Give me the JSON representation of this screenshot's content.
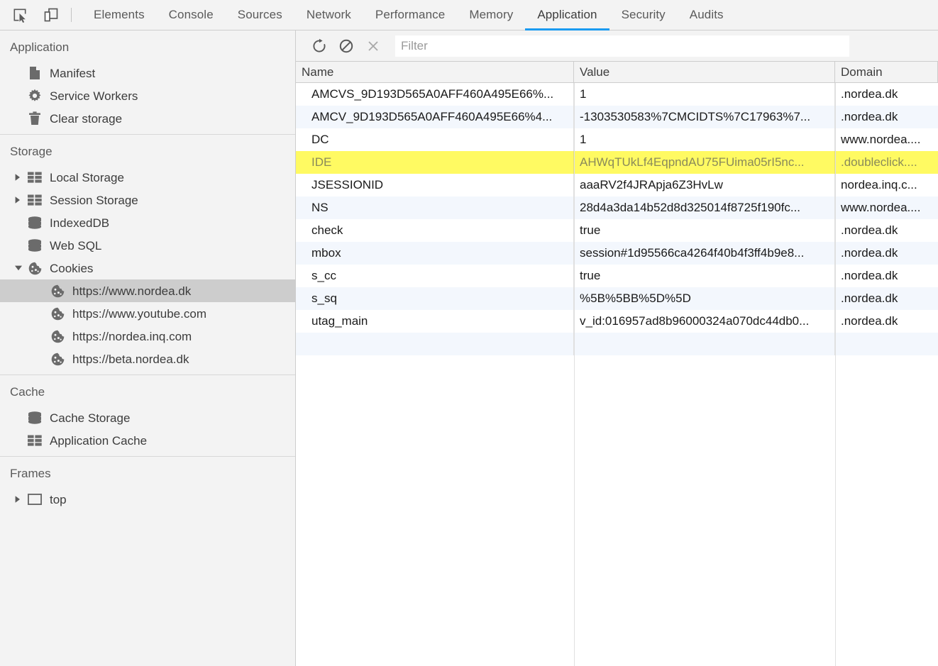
{
  "toolbar": {
    "inspect_icon": "inspect-element-icon",
    "device_icon": "device-toolbar-icon",
    "tabs": [
      {
        "label": "Elements",
        "active": false
      },
      {
        "label": "Console",
        "active": false
      },
      {
        "label": "Sources",
        "active": false
      },
      {
        "label": "Network",
        "active": false
      },
      {
        "label": "Performance",
        "active": false
      },
      {
        "label": "Memory",
        "active": false
      },
      {
        "label": "Application",
        "active": true
      },
      {
        "label": "Security",
        "active": false
      },
      {
        "label": "Audits",
        "active": false
      }
    ]
  },
  "sidebar": {
    "sections": [
      {
        "title": "Application",
        "items": [
          {
            "label": "Manifest",
            "icon": "manifest-file-icon",
            "arrow": "none",
            "indent": 1,
            "selected": false
          },
          {
            "label": "Service Workers",
            "icon": "gear-icon",
            "arrow": "none",
            "indent": 1,
            "selected": false
          },
          {
            "label": "Clear storage",
            "icon": "trash-icon",
            "arrow": "none",
            "indent": 1,
            "selected": false
          }
        ]
      },
      {
        "title": "Storage",
        "items": [
          {
            "label": "Local Storage",
            "icon": "table-icon",
            "arrow": "collapsed",
            "indent": 1,
            "selected": false
          },
          {
            "label": "Session Storage",
            "icon": "table-icon",
            "arrow": "collapsed",
            "indent": 1,
            "selected": false
          },
          {
            "label": "IndexedDB",
            "icon": "database-icon",
            "arrow": "none",
            "indent": 1,
            "selected": false
          },
          {
            "label": "Web SQL",
            "icon": "database-icon",
            "arrow": "none",
            "indent": 1,
            "selected": false
          },
          {
            "label": "Cookies",
            "icon": "cookie-icon",
            "arrow": "expanded",
            "indent": 1,
            "selected": false
          },
          {
            "label": "https://www.nordea.dk",
            "icon": "cookie-icon",
            "arrow": "none",
            "indent": 2,
            "selected": true
          },
          {
            "label": "https://www.youtube.com",
            "icon": "cookie-icon",
            "arrow": "none",
            "indent": 2,
            "selected": false
          },
          {
            "label": "https://nordea.inq.com",
            "icon": "cookie-icon",
            "arrow": "none",
            "indent": 2,
            "selected": false
          },
          {
            "label": "https://beta.nordea.dk",
            "icon": "cookie-icon",
            "arrow": "none",
            "indent": 2,
            "selected": false
          }
        ]
      },
      {
        "title": "Cache",
        "items": [
          {
            "label": "Cache Storage",
            "icon": "database-icon",
            "arrow": "none",
            "indent": 1,
            "selected": false
          },
          {
            "label": "Application Cache",
            "icon": "table-icon",
            "arrow": "none",
            "indent": 1,
            "selected": false
          }
        ]
      },
      {
        "title": "Frames",
        "items": [
          {
            "label": "top",
            "icon": "frame-icon",
            "arrow": "collapsed",
            "indent": 1,
            "selected": false
          }
        ]
      }
    ]
  },
  "cookie_panel": {
    "toolbar": {
      "refresh_icon": "refresh-icon",
      "clear_icon": "clear-all-cookies-icon",
      "delete_icon": "delete-selected-cookie-icon",
      "filter_placeholder": "Filter",
      "filter_value": ""
    },
    "columns": [
      "Name",
      "Value",
      "Domain"
    ],
    "rows": [
      {
        "name": "AMCVS_9D193D565A0AFF460A495E66%...",
        "value": "1",
        "domain": ".nordea.dk",
        "highlight": false
      },
      {
        "name": "AMCV_9D193D565A0AFF460A495E66%4...",
        "value": "-1303530583%7CMCIDTS%7C17963%7...",
        "domain": ".nordea.dk",
        "highlight": false
      },
      {
        "name": "DC",
        "value": "1",
        "domain": "www.nordea....",
        "highlight": false
      },
      {
        "name": "IDE",
        "value": "AHWqTUkLf4EqpndAU75FUima05rI5nc...",
        "domain": ".doubleclick....",
        "highlight": true
      },
      {
        "name": "JSESSIONID",
        "value": "aaaRV2f4JRApja6Z3HvLw",
        "domain": "nordea.inq.c...",
        "highlight": false
      },
      {
        "name": "NS",
        "value": "28d4a3da14b52d8d325014f8725f190fc...",
        "domain": "www.nordea....",
        "highlight": false
      },
      {
        "name": "check",
        "value": "true",
        "domain": ".nordea.dk",
        "highlight": false
      },
      {
        "name": "mbox",
        "value": "session#1d95566ca4264f40b4f3ff4b9e8...",
        "domain": ".nordea.dk",
        "highlight": false
      },
      {
        "name": "s_cc",
        "value": "true",
        "domain": ".nordea.dk",
        "highlight": false
      },
      {
        "name": "s_sq",
        "value": "%5B%5BB%5D%5D",
        "domain": ".nordea.dk",
        "highlight": false
      },
      {
        "name": "utag_main",
        "value": "v_id:016957ad8b96000324a070dc44db0...",
        "domain": ".nordea.dk",
        "highlight": false
      },
      {
        "name": "",
        "value": "",
        "domain": "",
        "highlight": false
      }
    ]
  },
  "colors": {
    "accent": "#1a9bf0",
    "highlight": "#fffa62",
    "stripe": "#f3f7fd",
    "chrome_bg": "#f3f3f3",
    "selection": "#cdcdcd"
  }
}
